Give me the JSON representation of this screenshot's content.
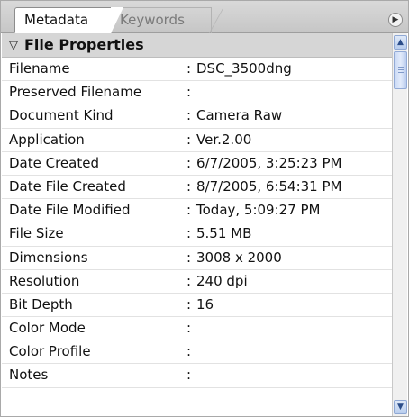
{
  "tabs": [
    {
      "label": "Metadata",
      "active": true
    },
    {
      "label": "Keywords",
      "active": false
    }
  ],
  "menu_button_icon": "flyout-menu-icon",
  "section": {
    "title": "File Properties",
    "expanded": true,
    "icon": "triangle-down-icon"
  },
  "rows": [
    {
      "label": "Filename",
      "value": "DSC_3500dng"
    },
    {
      "label": "Preserved Filename",
      "value": ""
    },
    {
      "label": "Document Kind",
      "value": "Camera Raw"
    },
    {
      "label": "Application",
      "value": "Ver.2.00"
    },
    {
      "label": "Date Created",
      "value": "6/7/2005, 3:25:23 PM"
    },
    {
      "label": "Date File Created",
      "value": "8/7/2005, 6:54:31 PM"
    },
    {
      "label": "Date File Modified",
      "value": "Today, 5:09:27 PM"
    },
    {
      "label": "File Size",
      "value": "5.51 MB"
    },
    {
      "label": "Dimensions",
      "value": "3008 x 2000"
    },
    {
      "label": "Resolution",
      "value": "240 dpi"
    },
    {
      "label": "Bit Depth",
      "value": "16"
    },
    {
      "label": "Color Mode",
      "value": ""
    },
    {
      "label": "Color Profile",
      "value": ""
    },
    {
      "label": "Notes",
      "value": ""
    }
  ],
  "separator": ":",
  "colors": {
    "tab_strip": "#c6c6c6",
    "section_header": "#d6d6d6",
    "scroll_accent": "#b8cdee"
  }
}
